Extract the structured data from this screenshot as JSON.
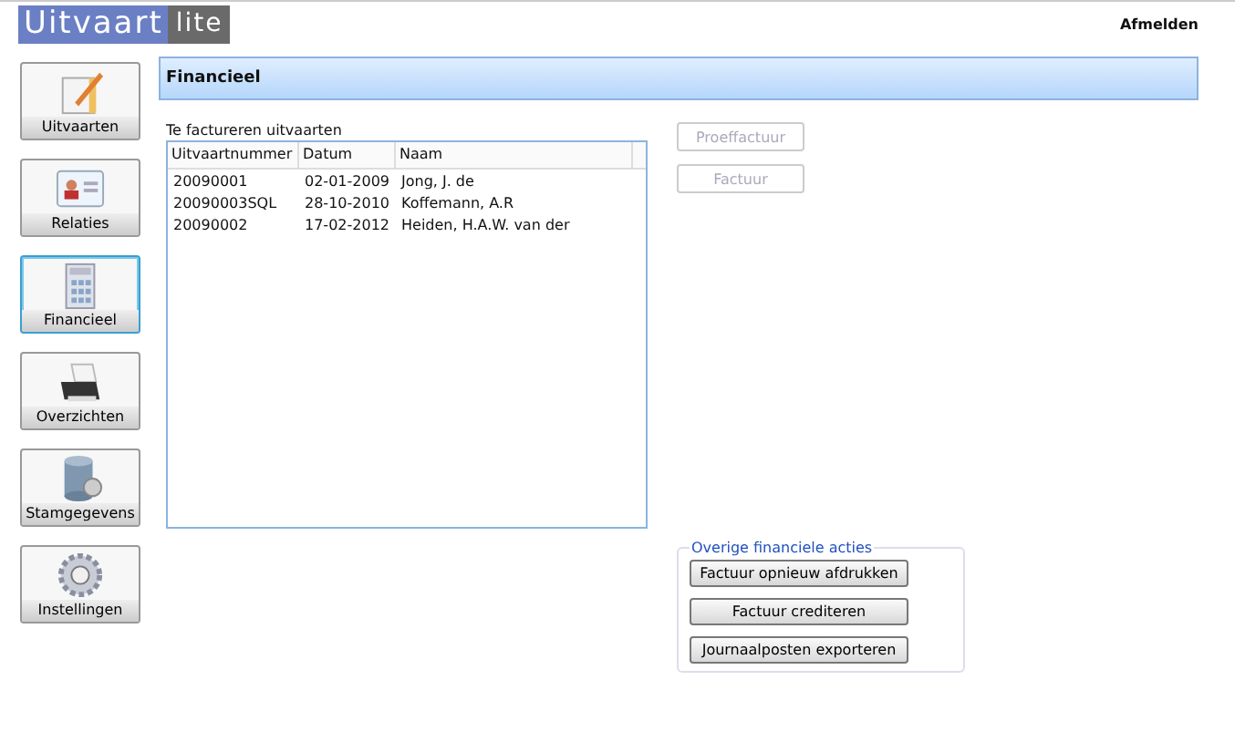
{
  "logo": {
    "main": "Uitvaart",
    "suffix": "lite"
  },
  "logout": "Afmelden",
  "nav": [
    {
      "label": "Uitvaarten",
      "kind": "notepad",
      "selected": false
    },
    {
      "label": "Relaties",
      "kind": "card",
      "selected": false
    },
    {
      "label": "Financieel",
      "kind": "calculator",
      "selected": true
    },
    {
      "label": "Overzichten",
      "kind": "printer",
      "selected": false
    },
    {
      "label": "Stamgegevens",
      "kind": "database",
      "selected": false
    },
    {
      "label": "Instellingen",
      "kind": "gear",
      "selected": false
    }
  ],
  "header": "Financieel",
  "list_label": "Te factureren uitvaarten",
  "table": {
    "columns": [
      "Uitvaartnummer",
      "Datum",
      "Naam"
    ],
    "rows": [
      [
        "20090001",
        "02-01-2009",
        "Jong, J. de"
      ],
      [
        "20090003SQL",
        "28-10-2010",
        "Koffemann, A.R"
      ],
      [
        "20090002",
        "17-02-2012",
        "Heiden, H.A.W. van der"
      ]
    ]
  },
  "actions": [
    {
      "label": "Proeffactuur",
      "disabled": true
    },
    {
      "label": "Factuur",
      "disabled": true
    }
  ],
  "other_actions": {
    "title": "Overige financiele acties",
    "buttons": [
      "Factuur opnieuw afdrukken",
      "Factuur crediteren",
      "Journaalposten  exporteren"
    ]
  }
}
